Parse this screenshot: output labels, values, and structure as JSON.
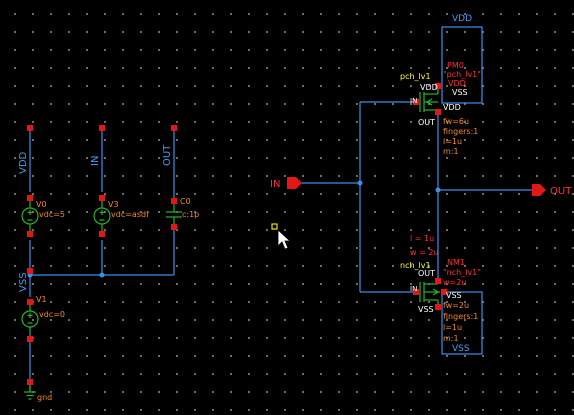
{
  "schematic": {
    "sources": {
      "vdd_net": "VDD",
      "in_net": "IN",
      "out_net": "OUT",
      "v0_name": "V0",
      "v0_param": "vdc=5",
      "v3_name": "V3",
      "v3_param": "vdc=asdf",
      "c0_name": "C0",
      "c0_param": "c:1p",
      "vss_net": "VSS",
      "v1_name": "V1",
      "v1_param": "vdc=0",
      "gnd_label": "gnd"
    },
    "ports": {
      "in_label": "IN",
      "out_label": "OUT"
    },
    "pmos": {
      "vdd_box": "VDD",
      "cell": "pch_lv1",
      "inst": "PM0",
      "inst_cell": "\"pch_lv1\"",
      "vdd_pin": "VDD",
      "vss_pin": "VSS",
      "pin_vdd": "VDD",
      "pin_in": "IN",
      "pin_vdd2": "VDD",
      "pin_out": "OUT",
      "fw": "fw=6u",
      "fingers": "fingers:1",
      "l": "l=1u",
      "m": "m:1"
    },
    "nmos": {
      "l_eq": "l = 1u",
      "w_eq": "w = 2u",
      "cell": "nch_lv1",
      "inst": "NM1",
      "pin_out": "OUT",
      "inst_cell": "\"nch_lv1\"",
      "w_param": "w=2u",
      "pin_in": "IN",
      "vss_pin": "VSS",
      "pin_vss": "VSS",
      "fw": "fw=2u",
      "fingers": "fingers:1",
      "l": "l=1u",
      "m": "m:1",
      "vss_box": "VSS"
    }
  },
  "colors": {
    "background": "#000000",
    "wire": "#3d8ee8",
    "component": "#26b626",
    "pin": "#e01818",
    "label_blue": "#4c9bf0",
    "label_orange": "#f08a2e",
    "label_yellow": "#ffff30",
    "label_red": "#ff3030",
    "label_white": "#ffffff",
    "cursor_marker": "#e8e800"
  }
}
